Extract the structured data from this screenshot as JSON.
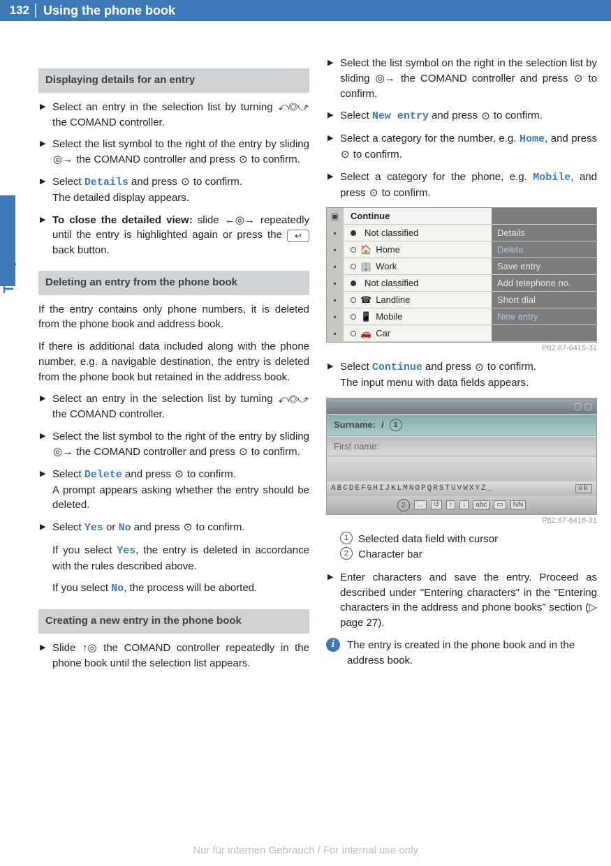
{
  "page_number": "132",
  "chapter_title": "Using the phone book",
  "side_label": "Telephone",
  "sections": {
    "s1_title": "Displaying details for an entry",
    "s1_1a": "Select an entry in the selection list by turning ",
    "s1_1b": " the COMAND controller.",
    "s1_2a": "Select the list symbol to the right of the entry by sliding ",
    "s1_2b": " the COMAND controller and press ",
    "s1_2c": " to confirm.",
    "s1_3a": "Select ",
    "s1_3u": "Details",
    "s1_3b": " and press ",
    "s1_3c": " to confirm.",
    "s1_3d": "The detailed display appears.",
    "s1_4bold": "To close the detailed view:",
    "s1_4a": " slide ",
    "s1_4b": " repeatedly until the entry is highlighted again or press the ",
    "s1_4c": " back button.",
    "s2_title": "Deleting an entry from the phone book",
    "s2_p1": "If the entry contains only phone numbers, it is deleted from the phone book and address book.",
    "s2_p2": "If there is additional data included along with the phone number, e.g. a navigable destination, the entry is deleted from the phone book but retained in the address book.",
    "s2_1a": "Select an entry in the selection list by turning ",
    "s2_1b": " the COMAND controller.",
    "s2_2a": "Select the list symbol to the right of the entry by sliding ",
    "s2_2b": " the COMAND controller and press ",
    "s2_2c": " to confirm.",
    "s2_3a": "Select ",
    "s2_3u": "Delete",
    "s2_3b": " and press ",
    "s2_3c": " to confirm.",
    "s2_3d": "A prompt appears asking whether the entry should be deleted.",
    "s2_4a": "Select ",
    "s2_4u1": "Yes",
    "s2_4m": " or ",
    "s2_4u2": "No",
    "s2_4b": " and press ",
    "s2_4c": " to confirm.",
    "s2_4d1": "If you select ",
    "s2_4d2": "Yes",
    "s2_4d3": ", the entry is deleted in accordance with the rules described above.",
    "s2_4e1": "If you select ",
    "s2_4e2": "No",
    "s2_4e3": ", the process will be aborted.",
    "s3_title": "Creating a new entry in the phone book",
    "s3_1a": "Slide ",
    "s3_1b": " the COMAND controller repeatedly in the phone book until the selection list appears.",
    "r1a": "Select the list symbol on the right in the selection list by sliding ",
    "r1b": " the COMAND controller and press ",
    "r1c": " to confirm.",
    "r2a": "Select ",
    "r2u": "New entry",
    "r2b": " and press ",
    "r2c": " to confirm.",
    "r3a": "Select a category for the number, e.g. ",
    "r3u": "Home",
    "r3b": ", and press ",
    "r3c": " to confirm.",
    "r4a": "Select a category for the phone, e.g. ",
    "r4u": "Mobile",
    "r4b": ", and press ",
    "r4c": " to confirm.",
    "r5a": "Select ",
    "r5u": "Continue",
    "r5b": " and press ",
    "r5c": " to confirm.",
    "r5d": "The input menu with data fields appears.",
    "legend1": "Selected data field with cursor",
    "legend2": "Character bar",
    "r6": "Enter characters and save the entry. Proceed as described under \"Entering characters\" in the \"Entering characters in the address and phone books\" section (▷ page 27).",
    "info": "The entry is created in the phone book and in the address book.",
    "back_btn": "↩"
  },
  "figure1": {
    "header": "Continue",
    "rows": [
      {
        "radio": "filled",
        "icon": "",
        "label": "Not classified",
        "right": "Details"
      },
      {
        "radio": "open",
        "icon": "🏠",
        "label": "Home",
        "right": "Delete",
        "rsel": true
      },
      {
        "radio": "open",
        "icon": "🏢",
        "label": "Work",
        "right": "Save entry"
      },
      {
        "radio": "filled",
        "icon": "",
        "label": "Not classified",
        "right": "Add telephone no."
      },
      {
        "radio": "open",
        "icon": "☎",
        "label": "Landline",
        "right": "Short dial"
      },
      {
        "radio": "open",
        "icon": "📱",
        "label": "Mobile",
        "right": "New entry",
        "rsel": true
      },
      {
        "radio": "open",
        "icon": "🚗",
        "label": "Car",
        "right": ""
      }
    ],
    "caption": "P82.87-6415-31"
  },
  "figure2": {
    "surname_label": "Surname:",
    "firstname_label": "First name:",
    "charbar": "ABCDEFGHIJKLMNOPQRSTUVWXYZ_",
    "ok": "ok",
    "caption": "P82.87-6416-31"
  },
  "footer": "Nur für internen Gebrauch / For internal use only",
  "glyphs": {
    "turn": "⤺◎⤻",
    "slide_right": "◎→",
    "press": "⊙",
    "slide_lr": "←◎→",
    "slide_up": "↑◎"
  }
}
